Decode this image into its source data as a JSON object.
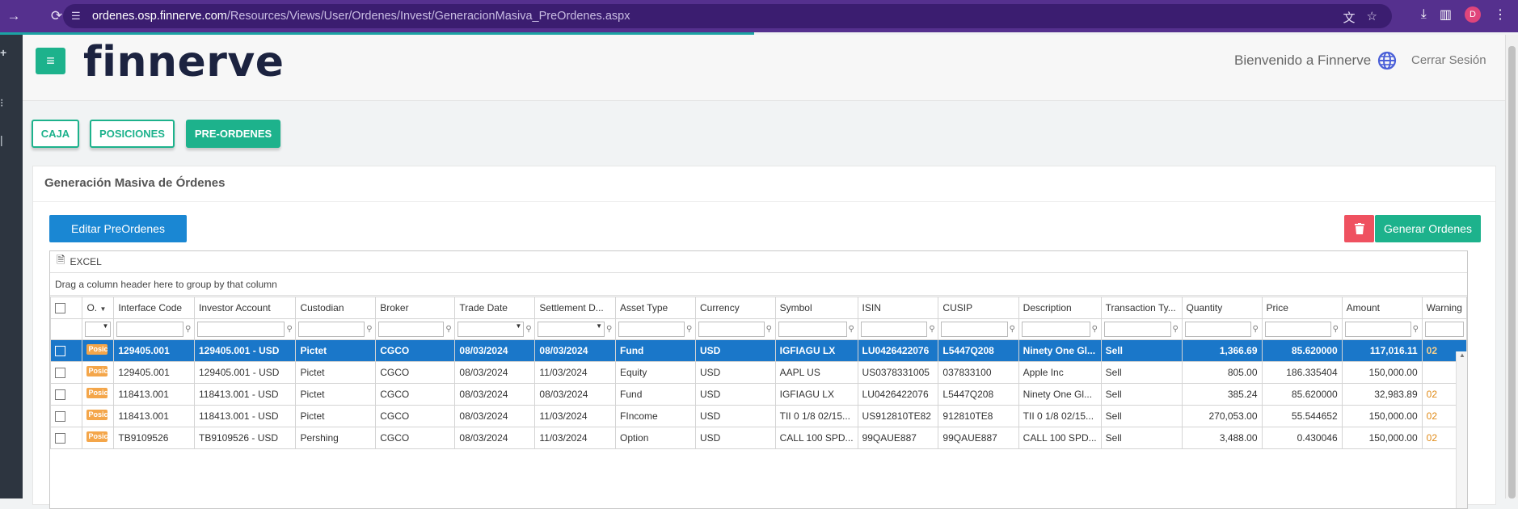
{
  "browser": {
    "url_host": "ordenes.osp.finnerve.com",
    "url_path": "/Resources/Views/User/Ordenes/Invest/GeneracionMasiva_PreOrdenes.aspx",
    "profile_initial": "D"
  },
  "header": {
    "logo": "finnerve",
    "welcome": "Bienvenido a Finnerve",
    "logout": "Cerrar Sesión"
  },
  "tabs": [
    {
      "label": "CAJA",
      "active": false
    },
    {
      "label": "POSICIONES",
      "active": false
    },
    {
      "label": "PRE-ORDENES",
      "active": true
    }
  ],
  "panel": {
    "title": "Generación Masiva de Órdenes",
    "edit_button": "Editar PreOrdenes",
    "generate_button": "Generar Ordenes",
    "excel_label": "EXCEL",
    "group_hint": "Drag a column header here to group by that column"
  },
  "grid": {
    "columns": [
      "O.",
      "Interface Code",
      "Investor Account",
      "Custodian",
      "Broker",
      "Trade Date",
      "Settlement D...",
      "Asset Type",
      "Currency",
      "Symbol",
      "ISIN",
      "CUSIP",
      "Description",
      "Transaction Ty...",
      "Quantity",
      "Price",
      "Amount",
      "Warning"
    ],
    "rows": [
      {
        "badge": "Posición",
        "interface_code": "129405.001",
        "investor_account": "129405.001 - USD",
        "custodian": "Pictet",
        "broker": "CGCO",
        "trade_date": "08/03/2024",
        "settlement_date": "08/03/2024",
        "asset_type": "Fund",
        "currency": "USD",
        "symbol": "IGFIAGU LX",
        "isin": "LU0426422076",
        "cusip": "L5447Q208",
        "description": "Ninety One Gl...",
        "transaction_type": "Sell",
        "quantity": "1,366.69",
        "price": "85.620000",
        "amount": "117,016.11",
        "warning": "02"
      },
      {
        "badge": "Posición",
        "interface_code": "129405.001",
        "investor_account": "129405.001 - USD",
        "custodian": "Pictet",
        "broker": "CGCO",
        "trade_date": "08/03/2024",
        "settlement_date": "11/03/2024",
        "asset_type": "Equity",
        "currency": "USD",
        "symbol": "AAPL US",
        "isin": "US0378331005",
        "cusip": "037833100",
        "description": "Apple Inc",
        "transaction_type": "Sell",
        "quantity": "805.00",
        "price": "186.335404",
        "amount": "150,000.00",
        "warning": ""
      },
      {
        "badge": "Posición",
        "interface_code": "118413.001",
        "investor_account": "118413.001 - USD",
        "custodian": "Pictet",
        "broker": "CGCO",
        "trade_date": "08/03/2024",
        "settlement_date": "08/03/2024",
        "asset_type": "Fund",
        "currency": "USD",
        "symbol": "IGFIAGU LX",
        "isin": "LU0426422076",
        "cusip": "L5447Q208",
        "description": "Ninety One Gl...",
        "transaction_type": "Sell",
        "quantity": "385.24",
        "price": "85.620000",
        "amount": "32,983.89",
        "warning": "02"
      },
      {
        "badge": "Posición",
        "interface_code": "118413.001",
        "investor_account": "118413.001 - USD",
        "custodian": "Pictet",
        "broker": "CGCO",
        "trade_date": "08/03/2024",
        "settlement_date": "11/03/2024",
        "asset_type": "FIncome",
        "currency": "USD",
        "symbol": "TII 0 1/8 02/15...",
        "isin": "US912810TE82",
        "cusip": "912810TE8",
        "description": "TII 0 1/8 02/15...",
        "transaction_type": "Sell",
        "quantity": "270,053.00",
        "price": "55.544652",
        "amount": "150,000.00",
        "warning": "02"
      },
      {
        "badge": "Posición",
        "interface_code": "TB9109526",
        "investor_account": "TB9109526 - USD",
        "custodian": "Pershing",
        "broker": "CGCO",
        "trade_date": "08/03/2024",
        "settlement_date": "11/03/2024",
        "asset_type": "Option",
        "currency": "USD",
        "symbol": "CALL 100 SPD...",
        "isin": "99QAUE887",
        "cusip": "99QAUE887",
        "description": "CALL 100 SPD...",
        "transaction_type": "Sell",
        "quantity": "3,488.00",
        "price": "0.430046",
        "amount": "150,000.00",
        "warning": "02"
      }
    ]
  }
}
